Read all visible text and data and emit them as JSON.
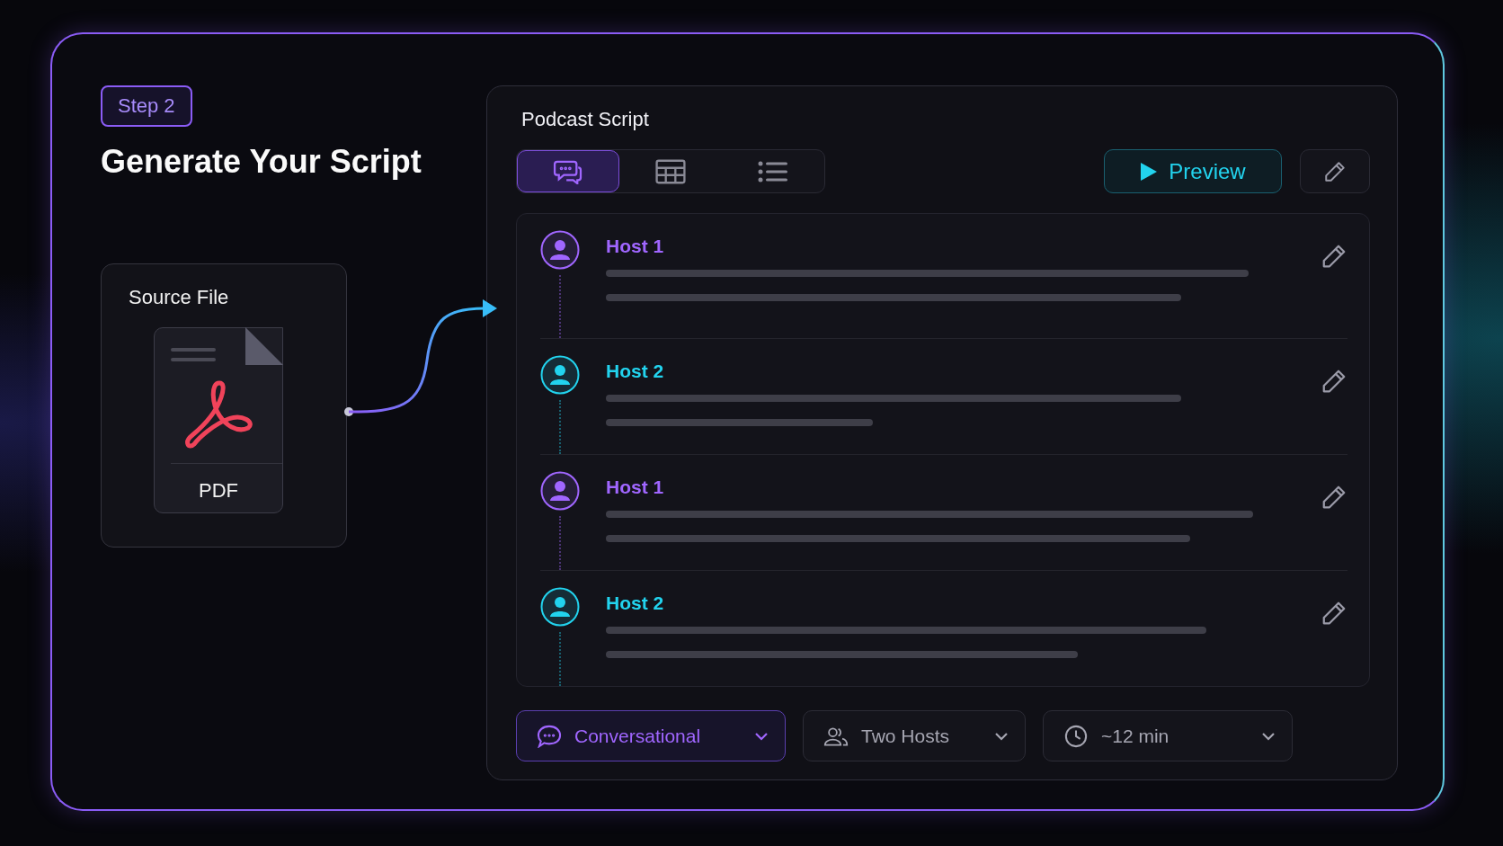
{
  "step_badge": "Step 2",
  "title": "Generate Your Script",
  "source_card": {
    "title": "Source File",
    "file_label": "PDF"
  },
  "script_panel": {
    "title": "Podcast Script",
    "view_tabs": [
      {
        "kind": "chat",
        "selected": true
      },
      {
        "kind": "table",
        "selected": false
      },
      {
        "kind": "list",
        "selected": false
      }
    ],
    "preview_button": "Preview",
    "entries": [
      {
        "speaker": "Host 1",
        "color": "#a066ff"
      },
      {
        "speaker": "Host 2",
        "color": "#22d3ee"
      },
      {
        "speaker": "Host 1",
        "color": "#a066ff"
      },
      {
        "speaker": "Host 2",
        "color": "#22d3ee"
      }
    ],
    "options": [
      {
        "kind": "style",
        "label": "Conversational",
        "selected": true
      },
      {
        "kind": "hosts",
        "label": "Two Hosts",
        "selected": false
      },
      {
        "kind": "duration",
        "label": "~12 min",
        "selected": false
      }
    ]
  }
}
